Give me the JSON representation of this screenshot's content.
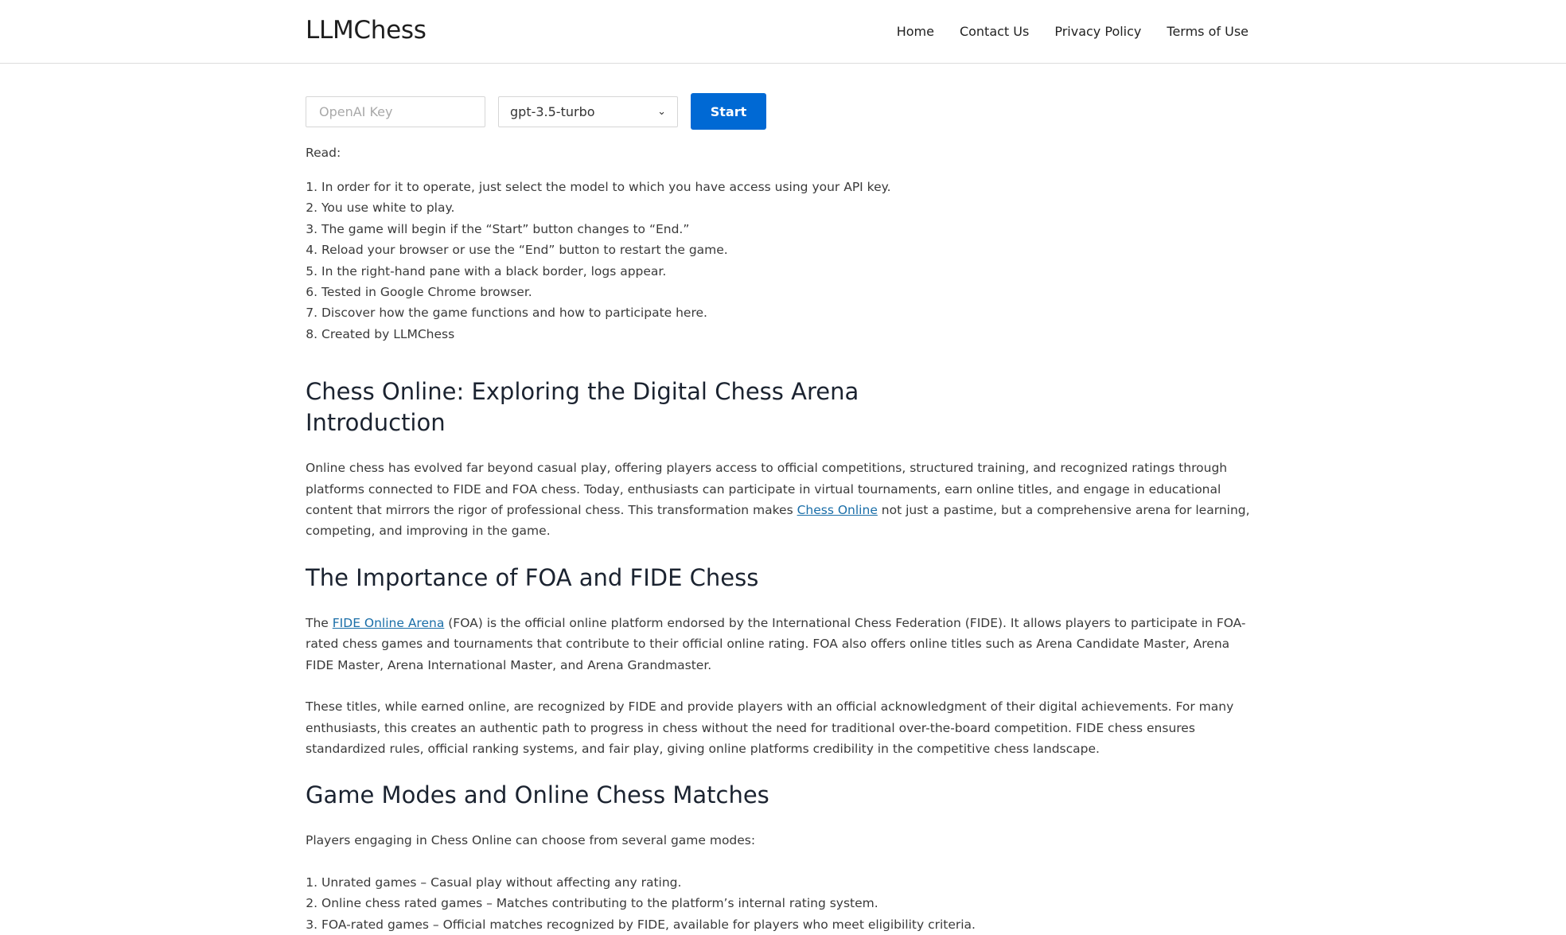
{
  "header": {
    "logo": "LLMChess",
    "nav": [
      "Home",
      "Contact Us",
      "Privacy Policy",
      "Terms of Use"
    ]
  },
  "controls": {
    "key_placeholder": "OpenAI Key",
    "model_selected": "gpt-3.5-turbo",
    "start_label": "Start"
  },
  "read_label": "Read:",
  "steps": [
    "In order for it to operate, just select the model to which you have access using your API key.",
    "You use white to play.",
    "The game will begin if the “Start” button changes to “End.”",
    "Reload your browser or use the “End” button to restart the game.",
    "In the right-hand pane with a black border, logs appear.",
    "Tested in Google Chrome browser.",
    "Discover how the game functions and how to participate here.",
    "Created by LLMChess"
  ],
  "section_intro": {
    "heading": "Chess Online: Exploring the Digital Chess Arena Introduction",
    "text_before": "Online chess has evolved far beyond casual play, offering players access to official competitions, structured training, and recognized ratings through platforms connected to FIDE and FOA chess. Today, enthusiasts can participate in virtual tournaments, earn online titles, and engage in educational content that mirrors the rigor of professional chess. This transformation makes ",
    "link": "Chess Online",
    "text_after": " not just a pastime, but a comprehensive arena for learning, competing, and improving in the game."
  },
  "section_foa": {
    "heading": "The Importance of FOA and FIDE Chess",
    "p1_before": "The ",
    "p1_link": "FIDE Online Arena",
    "p1_after": " (FOA) is the official online platform endorsed by the International Chess Federation (FIDE). It allows players to participate in FOA-rated chess games and tournaments that contribute to their official online rating. FOA also offers online titles such as Arena Candidate Master, Arena FIDE Master, Arena International Master, and Arena Grandmaster.",
    "p2": "These titles, while earned online, are recognized by FIDE and provide players with an official acknowledgment of their digital achievements. For many enthusiasts, this creates an authentic path to progress in chess without the need for traditional over-the-board competition. FIDE chess ensures standardized rules, official ranking systems, and fair play, giving online platforms credibility in the competitive chess landscape."
  },
  "section_modes": {
    "heading": "Game Modes and Online Chess Matches",
    "intro": "Players engaging in Chess Online can choose from several game modes:",
    "items": [
      "Unrated games – Casual play without affecting any rating.",
      "Online chess rated games – Matches contributing to the platform’s internal rating system.",
      "FOA-rated games – Official matches recognized by FIDE, available for players who meet eligibility criteria."
    ]
  }
}
